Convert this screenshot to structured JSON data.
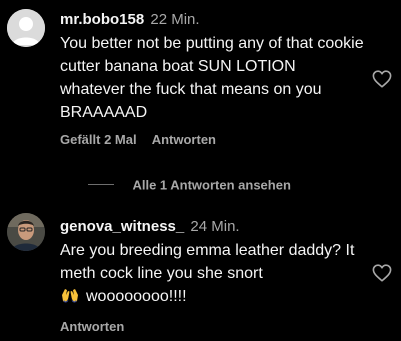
{
  "comments": [
    {
      "username": "mr.bobo158",
      "time": "22 Min.",
      "text": "You better not be putting any of that cookie cutter banana boat SUN LOTION whatever the fuck that means on you BRAAAAAD",
      "likes_label": "Gefällt 2 Mal",
      "reply_label": "Antworten",
      "avatar_icon": "default-avatar-icon"
    },
    {
      "username": "genova_witness_",
      "time": "24 Min.",
      "text": "Are you breeding emma leather daddy? It meth cock line you she snort",
      "text_tail": "woooooooo!!!!",
      "emoji_icon": "raised-hands-emoji",
      "reply_label": "Antworten",
      "avatar_icon": "profile-photo-avatar"
    }
  ],
  "replies_toggle": "Alle 1 Antworten ansehen",
  "colors": {
    "background": "#000000",
    "primary_text": "#f5f5f5",
    "secondary_text": "#a8a8a8"
  }
}
